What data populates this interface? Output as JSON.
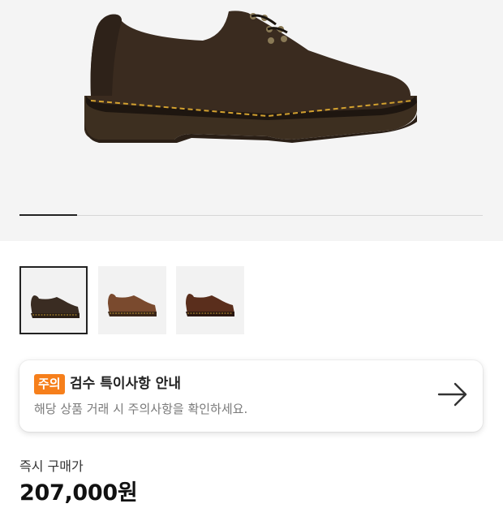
{
  "gallery": {
    "main_image": "dark-brown-leather-derby-shoe",
    "current_slide": 1,
    "total_slides": 8,
    "thumbnails": [
      {
        "name": "dark-brown-shoe",
        "color": "#3a2c22",
        "active": true
      },
      {
        "name": "light-brown-shoe",
        "color": "#7a4a2e",
        "active": false
      },
      {
        "name": "reddish-brown-shoe",
        "color": "#5a2e1c",
        "active": false
      }
    ]
  },
  "notice": {
    "badge": "주의",
    "title": "검수 특이사항 안내",
    "subtitle": "해당 상품 거래 시 주의사항을 확인하세요.",
    "arrow_icon": "arrow-right-icon",
    "badge_color": "#f67f1b"
  },
  "price": {
    "label": "즉시 구매가",
    "value": "207,000원"
  }
}
